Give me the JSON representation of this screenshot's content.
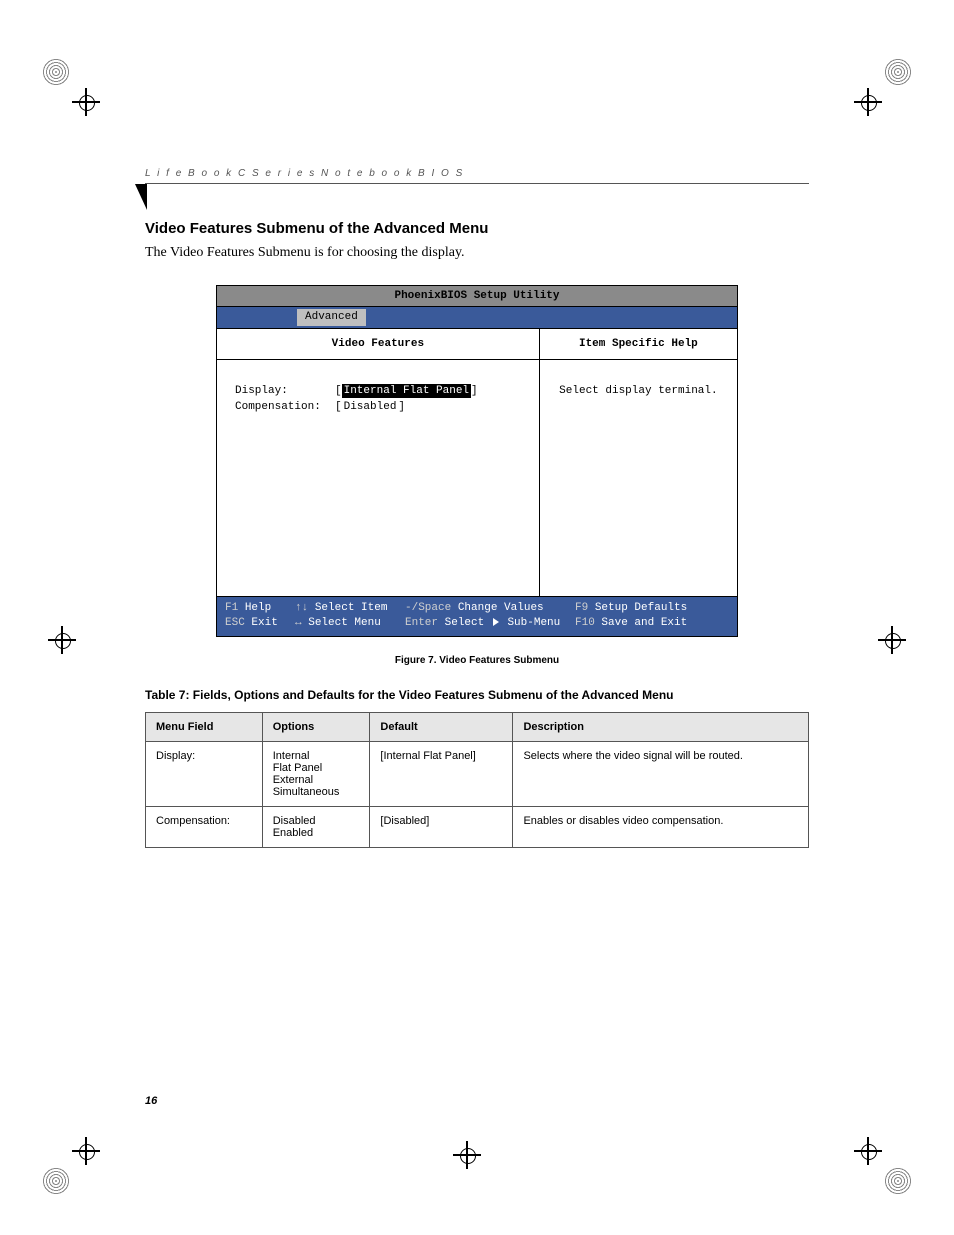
{
  "header": "L i f e B o o k   C   S e r i e s   N o t e b o o k   B I O S",
  "section_title": "Video Features Submenu of the Advanced Menu",
  "section_body": "The Video Features Submenu is for choosing the display.",
  "bios": {
    "title": "PhoenixBIOS Setup Utility",
    "active_tab": "Advanced",
    "panel_title": "Video Features",
    "help_title": "Item Specific Help",
    "help_text": "Select display terminal.",
    "rows": [
      {
        "label": "Display:",
        "value": "Internal Flat Panel",
        "highlight": true
      },
      {
        "label": "Compensation:",
        "value": "Disabled",
        "highlight": false
      }
    ],
    "footer": {
      "r1c1k": "F1",
      "r1c1t": "Help",
      "r1c2k": "↑↓",
      "r1c2t": "Select Item",
      "r1c3k": "-/Space",
      "r1c3t": "Change Values",
      "r1c4k": "F9",
      "r1c4t": "Setup Defaults",
      "r2c1k": "ESC",
      "r2c1t": "Exit",
      "r2c2k": "↔",
      "r2c2t": "Select Menu",
      "r2c3k": "Enter",
      "r2c3t_a": "Select",
      "r2c3t_b": "Sub-Menu",
      "r2c4k": "F10",
      "r2c4t": "Save and Exit"
    }
  },
  "figure_caption": "Figure 7.  Video Features Submenu",
  "table_title": "Table 7: Fields, Options and Defaults for the Video Features Submenu of the Advanced Menu",
  "table": {
    "headers": [
      "Menu Field",
      "Options",
      "Default",
      "Description"
    ],
    "rows": [
      {
        "field": "Display:",
        "options": "Internal\nFlat Panel\nExternal\nSimultaneous",
        "default": "[Internal Flat Panel]",
        "desc": "Selects where the video signal will be routed."
      },
      {
        "field": "Compensation:",
        "options": "Disabled\nEnabled",
        "default": "[Disabled]",
        "desc": "Enables or disables video compensation."
      }
    ]
  },
  "page_number": "16"
}
